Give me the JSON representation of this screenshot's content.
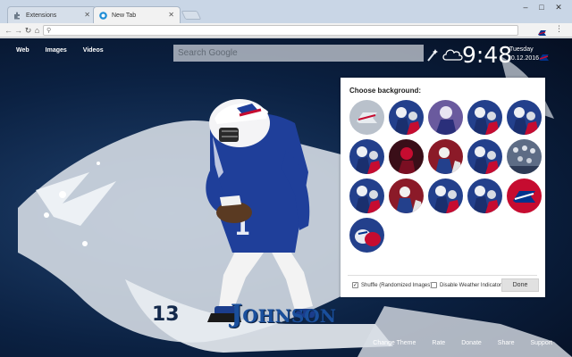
{
  "browser": {
    "tabs": [
      {
        "label": "Extensions",
        "active": false,
        "icon": "puzzle-icon"
      },
      {
        "label": "New Tab",
        "active": true,
        "icon": "newtab-icon"
      }
    ],
    "window_controls": {
      "minimize": "–",
      "maximize": "□",
      "close": "✕"
    },
    "omnibox_value": ""
  },
  "page": {
    "search_links": [
      "Web",
      "Images",
      "Videos"
    ],
    "search_placeholder": "Search Google",
    "clock": "9:48",
    "weekday": "Tuesday",
    "date": "20.12.2016",
    "player_number": "13",
    "player_name": "Johnson",
    "footer_links": [
      "Change Theme",
      "Rate",
      "Donate",
      "Share",
      "Support"
    ],
    "colors": {
      "team_blue": "#00338d",
      "team_red": "#c60c30",
      "navy": "#0b2142"
    }
  },
  "chooser": {
    "title": "Choose background:",
    "thumbnails": [
      {
        "name": "bg-1",
        "kind": "logo-grey"
      },
      {
        "name": "bg-2",
        "kind": "players"
      },
      {
        "name": "bg-3",
        "kind": "purple-player"
      },
      {
        "name": "bg-4",
        "kind": "players"
      },
      {
        "name": "bg-5",
        "kind": "players"
      },
      {
        "name": "bg-6",
        "kind": "players"
      },
      {
        "name": "bg-7",
        "kind": "red-dark"
      },
      {
        "name": "bg-8",
        "kind": "players-red"
      },
      {
        "name": "bg-9",
        "kind": "players"
      },
      {
        "name": "bg-10",
        "kind": "crowd"
      },
      {
        "name": "bg-11",
        "kind": "players"
      },
      {
        "name": "bg-12",
        "kind": "players-red"
      },
      {
        "name": "bg-13",
        "kind": "players"
      },
      {
        "name": "bg-14",
        "kind": "players"
      },
      {
        "name": "bg-15",
        "kind": "logo-red"
      },
      {
        "name": "bg-16",
        "kind": "helmets"
      }
    ],
    "shuffle_label": "Shuffle (Randomized Images)",
    "shuffle_checked": true,
    "weather_label": "Disable Weather Indicator",
    "weather_checked": false,
    "done_label": "Done"
  }
}
